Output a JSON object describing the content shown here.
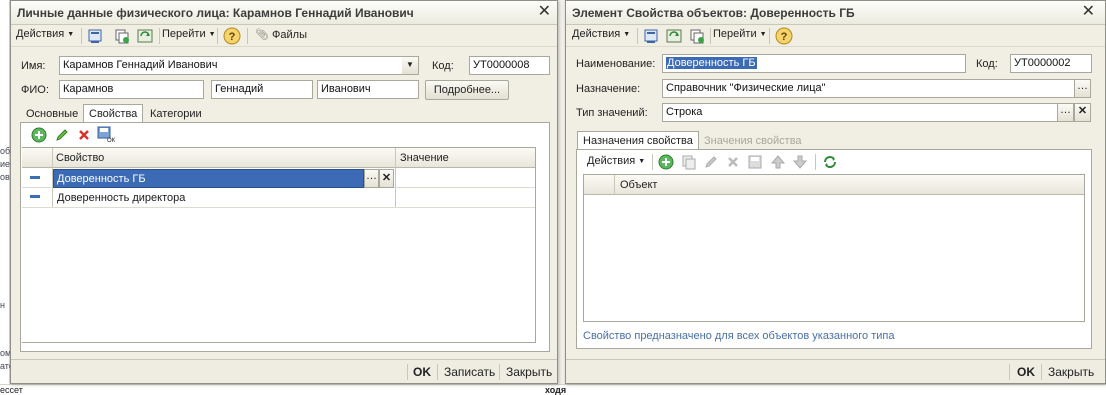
{
  "background": {
    "left_fragments": [
      "об",
      "ие",
      "ове",
      "н",
      "ом",
      "ато",
      "ессет"
    ],
    "bottom_fragments": [
      "ходя"
    ]
  },
  "left_window": {
    "title": "Личные данные физического лица: Карамнов Геннадий Иванович",
    "toolbar": {
      "actions": "Действия",
      "goto": "Перейти",
      "files": "Файлы"
    },
    "name_label": "Имя:",
    "name_value": "Карамнов Геннадий Иванович",
    "code_label": "Код:",
    "code_value": "УТ0000008",
    "fio_label": "ФИО:",
    "fio_last": "Карамнов",
    "fio_first": "Геннадий",
    "fio_middle": "Иванович",
    "more_button": "Подробнее...",
    "tabs": [
      "Основные",
      "Свойства",
      "Категории"
    ],
    "grid": {
      "headers": [
        "Свойство",
        "Значение"
      ],
      "rows": [
        {
          "property": "Доверенность ГБ",
          "value": ""
        },
        {
          "property": "Доверенность директора",
          "value": ""
        }
      ]
    },
    "footer": {
      "ok": "OK",
      "save": "Записать",
      "close": "Закрыть"
    }
  },
  "right_window": {
    "title": "Элемент Свойства объектов: Доверенность ГБ",
    "toolbar": {
      "actions": "Действия",
      "goto": "Перейти"
    },
    "name_label": "Наименование:",
    "name_value": "Доверенность ГБ",
    "code_label": "Код:",
    "code_value": "УТ0000002",
    "purpose_label": "Назначение:",
    "purpose_value": "Справочник \"Физические лица\"",
    "type_label": "Тип значений:",
    "type_value": "Строка",
    "tabs": [
      "Назначения свойства",
      "Значения свойства"
    ],
    "inner_toolbar": {
      "actions": "Действия"
    },
    "grid": {
      "headers": [
        "Объект"
      ]
    },
    "hint": "Свойство предназначено для всех объектов указанного типа",
    "footer": {
      "ok": "OK",
      "close": "Закрыть"
    }
  },
  "colors": {
    "selection": "#3c6ab4",
    "hint_text": "#4a6fa8",
    "window_bg": "#f1efe4"
  }
}
